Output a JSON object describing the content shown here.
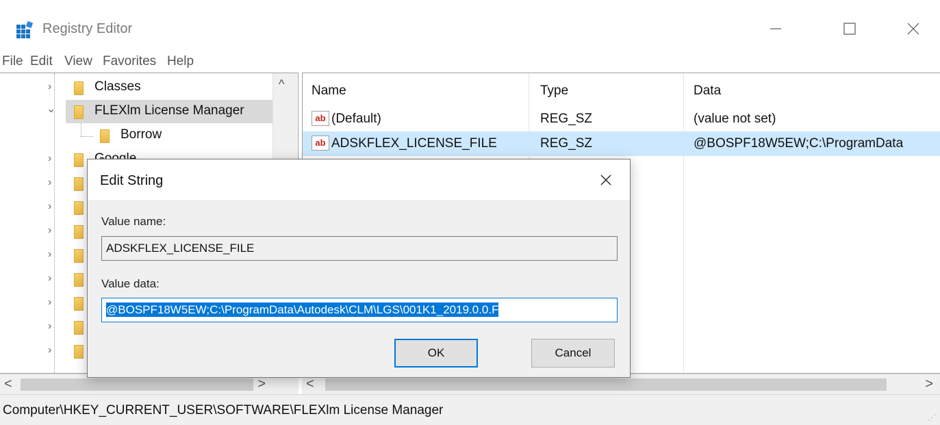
{
  "window": {
    "title": "Registry Editor",
    "min_glyph": "—",
    "close_glyph": "✕"
  },
  "menu": [
    "File",
    "Edit",
    "View",
    "Favorites",
    "Help"
  ],
  "tree": {
    "items": [
      {
        "label": "Classes",
        "expander": "›"
      },
      {
        "label": "FLEXlm License Manager",
        "expander": "⌄"
      },
      {
        "label": "Borrow",
        "expander": ""
      },
      {
        "label": "Google",
        "expander": "›"
      }
    ],
    "scroll_up": "^",
    "scroll_left": "<",
    "scroll_right": ">"
  },
  "list": {
    "columns": [
      "Name",
      "Type",
      "Data"
    ],
    "rows": [
      {
        "icon": "ab",
        "name": "(Default)",
        "type": "REG_SZ",
        "data": "(value not set)"
      },
      {
        "icon": "ab",
        "name": "ADSKFLEX_LICENSE_FILE",
        "type": "REG_SZ",
        "data": "@BOSPF18W5EW;C:\\ProgramData"
      }
    ],
    "scroll_left": "<",
    "scroll_right": ">"
  },
  "status": {
    "path": "Computer\\HKEY_CURRENT_USER\\SOFTWARE\\FLEXlm License Manager"
  },
  "dialog": {
    "title": "Edit String",
    "value_name_label": "Value name:",
    "value_name": "ADSKFLEX_LICENSE_FILE",
    "value_data_label": "Value data:",
    "value_data": "@BOSPF18W5EW;C:\\ProgramData\\Autodesk\\CLM\\LGS\\001K1_2019.0.0.F",
    "ok_label": "OK",
    "cancel_label": "Cancel",
    "close_glyph": "✕"
  },
  "colors": {
    "selection": "#cce8ff",
    "accent": "#0078d7",
    "folder": "#f0c050"
  }
}
